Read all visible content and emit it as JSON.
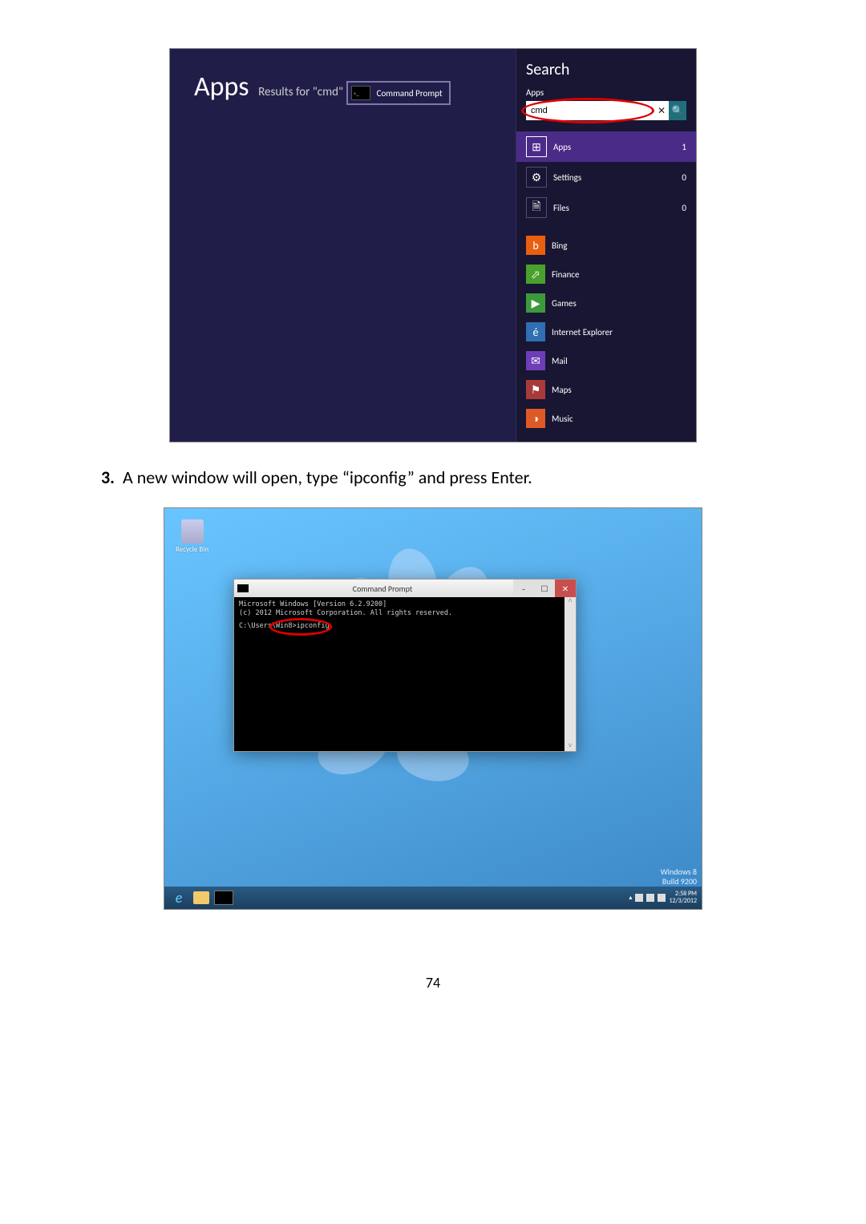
{
  "figure1": {
    "heading": "Apps",
    "subheading": "Results for \"cmd\"",
    "result": "Command Prompt",
    "search_title": "Search",
    "search_scope": "Apps",
    "search_value": "cmd",
    "categories": [
      {
        "label": "Apps",
        "count": "1",
        "icon": "⊞",
        "selected": true
      },
      {
        "label": "Settings",
        "count": "0",
        "icon": "⚙",
        "selected": false
      },
      {
        "label": "Files",
        "count": "0",
        "icon": "🗎",
        "selected": false
      }
    ],
    "apps": [
      {
        "label": "Bing",
        "icon": "b",
        "bg": "bg-bing"
      },
      {
        "label": "Finance",
        "icon": "⬀",
        "bg": "bg-fin"
      },
      {
        "label": "Games",
        "icon": "▶",
        "bg": "bg-games"
      },
      {
        "label": "Internet Explorer",
        "icon": "é",
        "bg": "bg-ie"
      },
      {
        "label": "Mail",
        "icon": "✉",
        "bg": "bg-mail"
      },
      {
        "label": "Maps",
        "icon": "⚑",
        "bg": "bg-maps"
      },
      {
        "label": "Music",
        "icon": "◑",
        "bg": "bg-music"
      }
    ]
  },
  "step": {
    "number": "3.",
    "text": "A new window will open, type “ipconfig” and press Enter."
  },
  "figure2": {
    "recycle_label": "Recycle Bin",
    "window_title": "Command Prompt",
    "line1": "Microsoft Windows [Version 6.2.9200]",
    "line2": "(c) 2012 Microsoft Corporation. All rights reserved.",
    "prompt": "C:\\Users\\Win8>ipconfig",
    "watermark1": "Windows 8",
    "watermark2": "Build 9200",
    "time": "2:58 PM",
    "date": "12/3/2012"
  },
  "page_number": "74"
}
